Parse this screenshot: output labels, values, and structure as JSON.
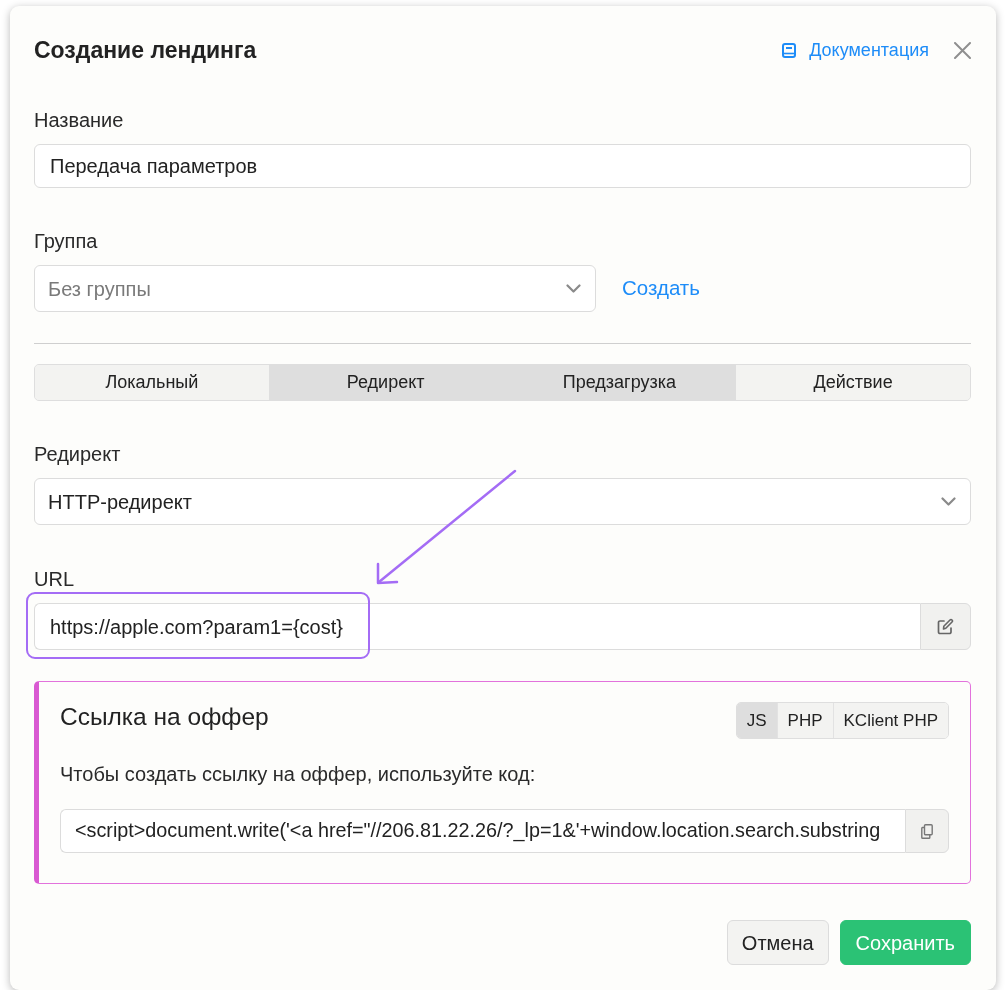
{
  "dialog": {
    "title": "Создание лендинга",
    "doc_link": "Документация"
  },
  "name_field": {
    "label": "Название",
    "value": "Передача параметров"
  },
  "group_field": {
    "label": "Группа",
    "placeholder": "Без группы",
    "create_link": "Создать"
  },
  "mode_tabs": [
    {
      "label": "Локальный",
      "selected": false
    },
    {
      "label": "Редирект",
      "selected": true
    },
    {
      "label": "Предзагрузка",
      "selected": true
    },
    {
      "label": "Действие",
      "selected": false
    }
  ],
  "redirect_field": {
    "label": "Редирект",
    "value": "HTTP-редирект"
  },
  "url_field": {
    "label": "URL",
    "value": "https://apple.com?param1={cost}",
    "highlighted": true,
    "pointed_by_arrow": true
  },
  "offer_link": {
    "title": "Ссылка на оффер",
    "formats": [
      {
        "label": "JS",
        "selected": true
      },
      {
        "label": "PHP",
        "selected": false
      },
      {
        "label": "KClient PHP",
        "selected": false
      }
    ],
    "hint": "Чтобы создать ссылку на оффер, используйте код:",
    "code": "<script>document.write('<a href=\"//206.81.22.26/?_lp=1&'+window.location.search.substring"
  },
  "buttons": [
    {
      "label": "Отмена",
      "kind": "secondary"
    },
    {
      "label": "Сохранить",
      "kind": "primary"
    }
  ]
}
